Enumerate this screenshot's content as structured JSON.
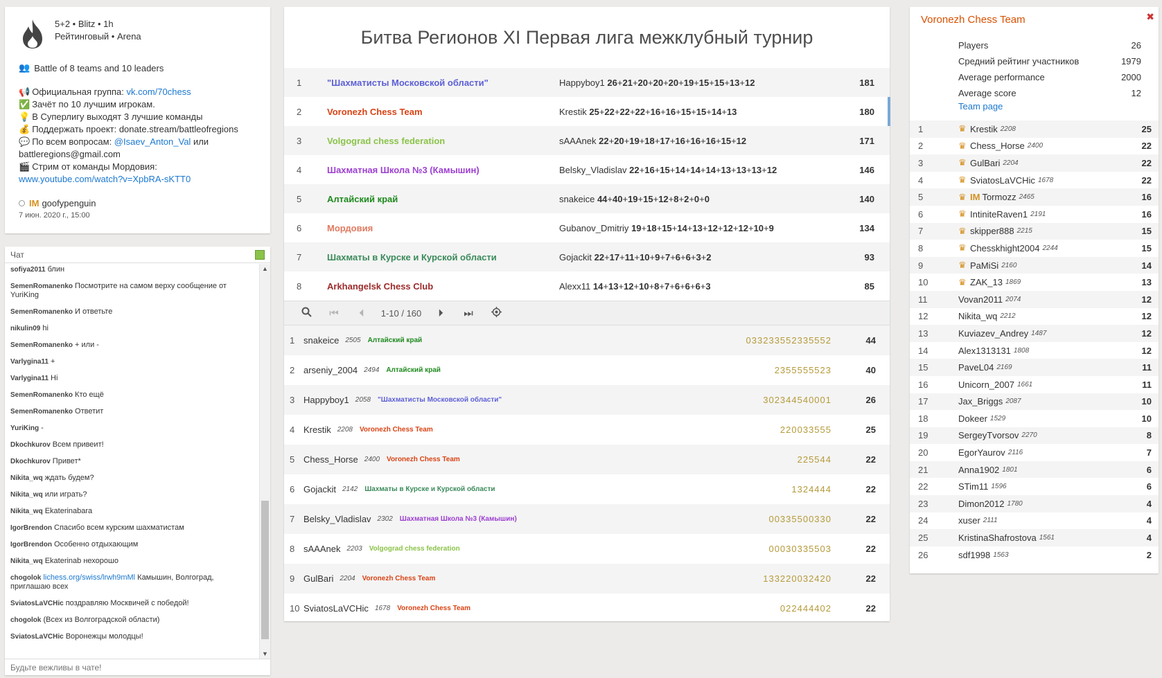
{
  "info": {
    "clock": "5+2 • Blitz • 1h",
    "rated": "Рейтинговый • Arena",
    "battle": "Battle of 8 teams and 10 leaders",
    "desc": [
      {
        "icon": "📢",
        "text": "Официальная группа: ",
        "link": "vk.com/70chess"
      },
      {
        "icon": "✅",
        "text": "Зачёт по 10 лучшим игрокам."
      },
      {
        "icon": "💡",
        "text": "В Суперлигу выходят 3 лучшие команды"
      },
      {
        "icon": "💰",
        "text": "Поддержать проект: donate.stream/battleofregions"
      },
      {
        "icon": "💬",
        "text": "По всем вопросам: ",
        "link": "@Isaev_Anton_Val",
        "after": " или battleregions@gmail.com"
      },
      {
        "icon": "🎬",
        "text": "Стрим от команды Мордовия: ",
        "link": "www.youtube.com/watch?v=XpbRA-sKTT0"
      }
    ],
    "creator_title": "IM",
    "creator": "goofypenguin",
    "date": "7 июн. 2020 г., 15:00"
  },
  "chat": {
    "label": "Чат",
    "placeholder": "Будьте вежливы в чате!",
    "messages": [
      {
        "u": "sofiya2011",
        "t": "блин"
      },
      {
        "u": "SemenRomanenko",
        "t": "Посмотрите на самом верху сообщение от YuriKing"
      },
      {
        "u": "SemenRomanenko",
        "t": "И ответьте"
      },
      {
        "u": "nikulin09",
        "t": "hi"
      },
      {
        "u": "SemenRomanenko",
        "t": "+ или -"
      },
      {
        "u": "Varlygina11",
        "t": "+"
      },
      {
        "u": "Varlygina11",
        "t": "Hi"
      },
      {
        "u": "SemenRomanenko",
        "t": "Кто ещё"
      },
      {
        "u": "SemenRomanenko",
        "t": "Ответит"
      },
      {
        "u": "YuriKing",
        "t": "-"
      },
      {
        "u": "Dkochkurov",
        "t": "Всем привеит!"
      },
      {
        "u": "Dkochkurov",
        "t": "Привет*"
      },
      {
        "u": "Nikita_wq",
        "t": "ждать будем?"
      },
      {
        "u": "Nikita_wq",
        "t": "или играть?"
      },
      {
        "u": "Nikita_wq",
        "t": "Ekaterinabara"
      },
      {
        "u": "IgorBrendon",
        "t": "Спасибо всем курским шахматистам"
      },
      {
        "u": "IgorBrendon",
        "t": "Особенно отдыхающим"
      },
      {
        "u": "Nikita_wq",
        "t": "Ekaterinab нехорошо"
      },
      {
        "u": "chogolok",
        "link": "lichess.org/swiss/lrwh9mMl",
        "t": "Камышин, Волгоград, приглашаю всех"
      },
      {
        "u": "SviatosLaVCHic",
        "t": "поздравляю Москвичей с победой!"
      },
      {
        "u": "chogolok",
        "t": "(Всех из Волгоградской области)"
      },
      {
        "u": "SviatosLaVCHic",
        "t": "Воронежцы молодцы!"
      }
    ]
  },
  "title": "Битва Регионов XI Первая лига межклубный турнир",
  "teams": [
    {
      "rank": "1",
      "name": "\"Шахматисты Московской области\"",
      "color": "#5c5fd6",
      "leader": "Happyboy1",
      "scores": [
        "26",
        "21",
        "20",
        "20",
        "20",
        "19",
        "15",
        "15",
        "13",
        "12"
      ],
      "total": "181"
    },
    {
      "rank": "2",
      "name": "Voronezh Chess Team",
      "color": "#d84315",
      "leader": "Krestik",
      "scores": [
        "25",
        "22",
        "22",
        "22",
        "16",
        "16",
        "15",
        "15",
        "14",
        "13"
      ],
      "total": "180",
      "selected": true
    },
    {
      "rank": "3",
      "name": "Volgograd chess federation",
      "color": "#8bc34a",
      "leader": "sAAAnek",
      "scores": [
        "22",
        "20",
        "19",
        "18",
        "17",
        "16",
        "16",
        "16",
        "15",
        "12"
      ],
      "total": "171"
    },
    {
      "rank": "4",
      "name": "Шахматная Школа №3 (Камышин)",
      "color": "#9c3fd0",
      "leader": "Belsky_Vladislav",
      "scores": [
        "22",
        "16",
        "15",
        "14",
        "14",
        "14",
        "13",
        "13",
        "13",
        "12"
      ],
      "total": "146"
    },
    {
      "rank": "5",
      "name": "Алтайский край",
      "color": "#1e8a1e",
      "leader": "snakeice",
      "scores": [
        "44",
        "40",
        "19",
        "15",
        "12",
        "8",
        "2",
        "0",
        "0"
      ],
      "total": "140"
    },
    {
      "rank": "6",
      "name": "Мордовия",
      "color": "#e07a5f",
      "leader": "Gubanov_Dmitriy",
      "scores": [
        "19",
        "18",
        "15",
        "14",
        "13",
        "12",
        "12",
        "12",
        "10",
        "9"
      ],
      "total": "134"
    },
    {
      "rank": "7",
      "name": "Шахматы в Курске и Курской области",
      "color": "#3a8a5a",
      "leader": "Gojackit",
      "scores": [
        "22",
        "17",
        "11",
        "10",
        "9",
        "7",
        "6",
        "6",
        "3",
        "2"
      ],
      "total": "93"
    },
    {
      "rank": "8",
      "name": "Arkhangelsk Chess Club",
      "color": "#9c2a2a",
      "leader": "Alexx11",
      "scores": [
        "14",
        "13",
        "12",
        "10",
        "8",
        "7",
        "6",
        "6",
        "6",
        "3"
      ],
      "total": "85"
    }
  ],
  "pager": {
    "range": "1-10 / 160"
  },
  "players": [
    {
      "rank": "1",
      "name": "snakeice",
      "rating": "2505",
      "team": "Алтайский край",
      "color": "#1e8a1e",
      "sheet": "033233552335552",
      "score": "44"
    },
    {
      "rank": "2",
      "name": "arseniy_2004",
      "rating": "2494",
      "team": "Алтайский край",
      "color": "#1e8a1e",
      "sheet": "2355555523",
      "score": "40"
    },
    {
      "rank": "3",
      "name": "Happyboy1",
      "rating": "2058",
      "team": "\"Шахматисты Московской области\"",
      "color": "#5c5fd6",
      "sheet": "302344540001",
      "score": "26"
    },
    {
      "rank": "4",
      "name": "Krestik",
      "rating": "2208",
      "team": "Voronezh Chess Team",
      "color": "#d84315",
      "sheet": "220033555",
      "score": "25"
    },
    {
      "rank": "5",
      "name": "Chess_Horse",
      "rating": "2400",
      "team": "Voronezh Chess Team",
      "color": "#d84315",
      "sheet": "225544",
      "score": "22"
    },
    {
      "rank": "6",
      "name": "Gojackit",
      "rating": "2142",
      "team": "Шахматы в Курске и Курской области",
      "color": "#3a8a5a",
      "sheet": "1324444",
      "score": "22"
    },
    {
      "rank": "7",
      "name": "Belsky_Vladislav",
      "rating": "2302",
      "team": "Шахматная Школа №3 (Камышин)",
      "color": "#9c3fd0",
      "sheet": "00335500330",
      "score": "22"
    },
    {
      "rank": "8",
      "name": "sAAAnek",
      "rating": "2203",
      "team": "Volgograd chess federation",
      "color": "#8bc34a",
      "sheet": "00030335503",
      "score": "22"
    },
    {
      "rank": "9",
      "name": "GulBari",
      "rating": "2204",
      "team": "Voronezh Chess Team",
      "color": "#d84315",
      "sheet": "133220032420",
      "score": "22"
    },
    {
      "rank": "10",
      "name": "SviatosLaVCHic",
      "rating": "1678",
      "team": "Voronezh Chess Team",
      "color": "#d84315",
      "sheet": "022444402",
      "score": "22"
    }
  ],
  "team_info": {
    "name": "Voronezh Chess Team",
    "stats": [
      {
        "k": "Players",
        "v": "26"
      },
      {
        "k": "Средний рейтинг участников",
        "v": "1979"
      },
      {
        "k": "Average performance",
        "v": "2000"
      },
      {
        "k": "Average score",
        "v": "12"
      }
    ],
    "team_page": "Team page",
    "players": [
      {
        "rank": "1",
        "name": "Krestik",
        "rating": "2208",
        "score": "25",
        "crown": true
      },
      {
        "rank": "2",
        "name": "Chess_Horse",
        "rating": "2400",
        "score": "22",
        "crown": true
      },
      {
        "rank": "3",
        "name": "GulBari",
        "rating": "2204",
        "score": "22",
        "crown": true
      },
      {
        "rank": "4",
        "name": "SviatosLaVCHic",
        "rating": "1678",
        "score": "22",
        "crown": true
      },
      {
        "rank": "5",
        "name": "Tormozz",
        "title": "IM",
        "rating": "2465",
        "score": "16",
        "crown": true
      },
      {
        "rank": "6",
        "name": "IntiniteRaven1",
        "rating": "2191",
        "score": "16",
        "crown": true
      },
      {
        "rank": "7",
        "name": "skipper888",
        "rating": "2215",
        "score": "15",
        "crown": true
      },
      {
        "rank": "8",
        "name": "Chesskhight2004",
        "rating": "2244",
        "score": "15",
        "crown": true
      },
      {
        "rank": "9",
        "name": "PaMiSi",
        "rating": "2160",
        "score": "14",
        "crown": true
      },
      {
        "rank": "10",
        "name": "ZAK_13",
        "rating": "1869",
        "score": "13",
        "crown": true
      },
      {
        "rank": "11",
        "name": "Vovan2011",
        "rating": "2074",
        "score": "12"
      },
      {
        "rank": "12",
        "name": "Nikita_wq",
        "rating": "2212",
        "score": "12"
      },
      {
        "rank": "13",
        "name": "Kuviazev_Andrey",
        "rating": "1487",
        "score": "12"
      },
      {
        "rank": "14",
        "name": "Alex1313131",
        "rating": "1808",
        "score": "12"
      },
      {
        "rank": "15",
        "name": "PaveL04",
        "rating": "2169",
        "score": "11"
      },
      {
        "rank": "16",
        "name": "Unicorn_2007",
        "rating": "1661",
        "score": "11"
      },
      {
        "rank": "17",
        "name": "Jax_Briggs",
        "rating": "2087",
        "score": "10"
      },
      {
        "rank": "18",
        "name": "Dokeer",
        "rating": "1529",
        "score": "10"
      },
      {
        "rank": "19",
        "name": "SergeyTvorsov",
        "rating": "2270",
        "score": "8"
      },
      {
        "rank": "20",
        "name": "EgorYaurov",
        "rating": "2116",
        "score": "7"
      },
      {
        "rank": "21",
        "name": "Anna1902",
        "rating": "1801",
        "score": "6"
      },
      {
        "rank": "22",
        "name": "STim11",
        "rating": "1596",
        "score": "6"
      },
      {
        "rank": "23",
        "name": "Dimon2012",
        "rating": "1780",
        "score": "4"
      },
      {
        "rank": "24",
        "name": "xuser",
        "rating": "2111",
        "score": "4"
      },
      {
        "rank": "25",
        "name": "KristinaShafrostova",
        "rating": "1561",
        "score": "4"
      },
      {
        "rank": "26",
        "name": "sdf1998",
        "rating": "1563",
        "score": "2"
      }
    ]
  }
}
